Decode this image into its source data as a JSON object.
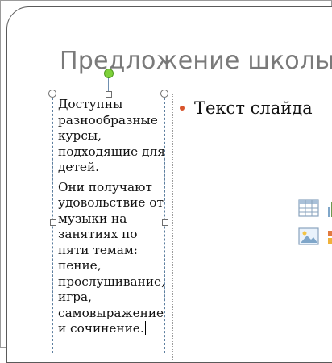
{
  "slide": {
    "title": "Предложение школы",
    "textbox_paragraphs": [
      "Доступны\nразнообразные\nкурсы,\nподходящие для\nдетей.",
      "Они получают\nудовольствие от\nмузыки на\nзанятиях по\nпяти темам:\nпение,\nпрослушивание,\nигра,\nсамовыражение\nи сочинение."
    ],
    "content_placeholder": {
      "bullet_text": "Текст слайда",
      "bullet_color": "#d8542c"
    },
    "insert_icons": [
      "table-icon",
      "chart-icon",
      "picture-icon",
      "clip-art-icon"
    ]
  },
  "colors": {
    "title_text": "#7a7a7a",
    "selection_border": "#5d7f9f",
    "rotation_handle": "#7ed13a"
  }
}
